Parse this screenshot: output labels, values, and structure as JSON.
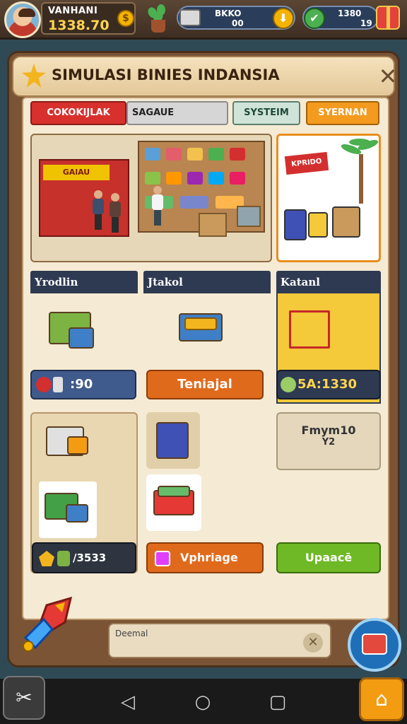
{
  "hud": {
    "player_name": "VANHANI",
    "player_coins": "1338.70",
    "coin_symbol": "$",
    "resource1_label": "BKKO",
    "resource1_value": "00",
    "resource2_label": "1380",
    "resource2_value": "19"
  },
  "panel": {
    "title": "SIMULASI BINIES INDANSIA",
    "close": "✕"
  },
  "tabs": [
    "COKOKIJLAK",
    "SAGAUE",
    "SYSTEIM",
    "SYERNAN"
  ],
  "scene": {
    "kiosk_sign": "GAlAU",
    "promo_sign": "KPRIDO"
  },
  "categories": {
    "c1": "Yrodlin",
    "c2": "Jtakol",
    "c3": "Katanl"
  },
  "prices": {
    "p1": ":90",
    "p2": "Teniajal",
    "p3": "5A:1330"
  },
  "info_card": {
    "title": "Fmym10",
    "sub": "Y2"
  },
  "actions": {
    "a1": "/3533",
    "a2": "Vphriage",
    "a3": "Upaacē"
  },
  "chat": {
    "label": "Deemal",
    "close": "✕"
  },
  "nav": {
    "back": "◁",
    "home": "○",
    "recent": "▢"
  },
  "colors": {
    "primary_tab": "#d8302c",
    "accent_orange": "#e06a1c",
    "accent_green": "#6fb826",
    "panel_bg": "#f5ead3",
    "dark_header": "#2e3a52"
  }
}
